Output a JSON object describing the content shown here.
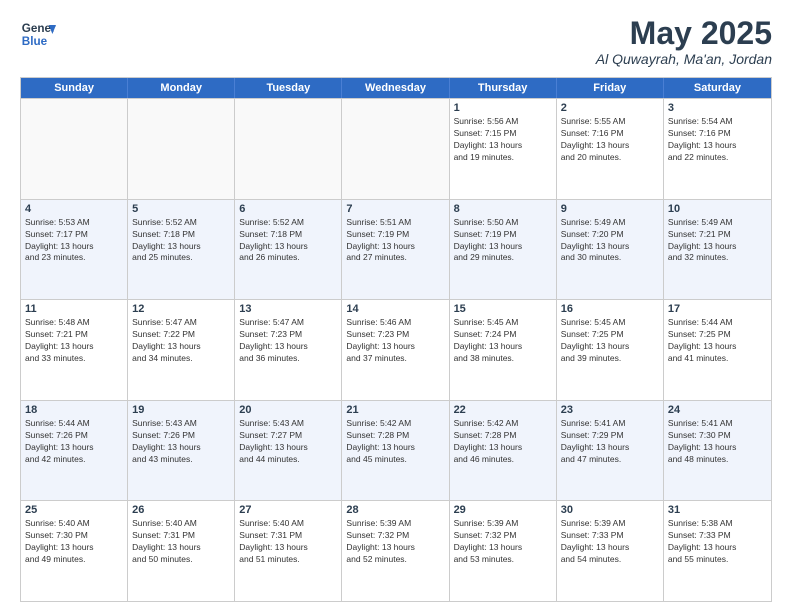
{
  "header": {
    "logo_line1": "General",
    "logo_line2": "Blue",
    "month": "May 2025",
    "location": "Al Quwayrah, Ma'an, Jordan"
  },
  "days_of_week": [
    "Sunday",
    "Monday",
    "Tuesday",
    "Wednesday",
    "Thursday",
    "Friday",
    "Saturday"
  ],
  "weeks": [
    [
      {
        "day": "",
        "info": ""
      },
      {
        "day": "",
        "info": ""
      },
      {
        "day": "",
        "info": ""
      },
      {
        "day": "",
        "info": ""
      },
      {
        "day": "1",
        "info": "Sunrise: 5:56 AM\nSunset: 7:15 PM\nDaylight: 13 hours\nand 19 minutes."
      },
      {
        "day": "2",
        "info": "Sunrise: 5:55 AM\nSunset: 7:16 PM\nDaylight: 13 hours\nand 20 minutes."
      },
      {
        "day": "3",
        "info": "Sunrise: 5:54 AM\nSunset: 7:16 PM\nDaylight: 13 hours\nand 22 minutes."
      }
    ],
    [
      {
        "day": "4",
        "info": "Sunrise: 5:53 AM\nSunset: 7:17 PM\nDaylight: 13 hours\nand 23 minutes."
      },
      {
        "day": "5",
        "info": "Sunrise: 5:52 AM\nSunset: 7:18 PM\nDaylight: 13 hours\nand 25 minutes."
      },
      {
        "day": "6",
        "info": "Sunrise: 5:52 AM\nSunset: 7:18 PM\nDaylight: 13 hours\nand 26 minutes."
      },
      {
        "day": "7",
        "info": "Sunrise: 5:51 AM\nSunset: 7:19 PM\nDaylight: 13 hours\nand 27 minutes."
      },
      {
        "day": "8",
        "info": "Sunrise: 5:50 AM\nSunset: 7:19 PM\nDaylight: 13 hours\nand 29 minutes."
      },
      {
        "day": "9",
        "info": "Sunrise: 5:49 AM\nSunset: 7:20 PM\nDaylight: 13 hours\nand 30 minutes."
      },
      {
        "day": "10",
        "info": "Sunrise: 5:49 AM\nSunset: 7:21 PM\nDaylight: 13 hours\nand 32 minutes."
      }
    ],
    [
      {
        "day": "11",
        "info": "Sunrise: 5:48 AM\nSunset: 7:21 PM\nDaylight: 13 hours\nand 33 minutes."
      },
      {
        "day": "12",
        "info": "Sunrise: 5:47 AM\nSunset: 7:22 PM\nDaylight: 13 hours\nand 34 minutes."
      },
      {
        "day": "13",
        "info": "Sunrise: 5:47 AM\nSunset: 7:23 PM\nDaylight: 13 hours\nand 36 minutes."
      },
      {
        "day": "14",
        "info": "Sunrise: 5:46 AM\nSunset: 7:23 PM\nDaylight: 13 hours\nand 37 minutes."
      },
      {
        "day": "15",
        "info": "Sunrise: 5:45 AM\nSunset: 7:24 PM\nDaylight: 13 hours\nand 38 minutes."
      },
      {
        "day": "16",
        "info": "Sunrise: 5:45 AM\nSunset: 7:25 PM\nDaylight: 13 hours\nand 39 minutes."
      },
      {
        "day": "17",
        "info": "Sunrise: 5:44 AM\nSunset: 7:25 PM\nDaylight: 13 hours\nand 41 minutes."
      }
    ],
    [
      {
        "day": "18",
        "info": "Sunrise: 5:44 AM\nSunset: 7:26 PM\nDaylight: 13 hours\nand 42 minutes."
      },
      {
        "day": "19",
        "info": "Sunrise: 5:43 AM\nSunset: 7:26 PM\nDaylight: 13 hours\nand 43 minutes."
      },
      {
        "day": "20",
        "info": "Sunrise: 5:43 AM\nSunset: 7:27 PM\nDaylight: 13 hours\nand 44 minutes."
      },
      {
        "day": "21",
        "info": "Sunrise: 5:42 AM\nSunset: 7:28 PM\nDaylight: 13 hours\nand 45 minutes."
      },
      {
        "day": "22",
        "info": "Sunrise: 5:42 AM\nSunset: 7:28 PM\nDaylight: 13 hours\nand 46 minutes."
      },
      {
        "day": "23",
        "info": "Sunrise: 5:41 AM\nSunset: 7:29 PM\nDaylight: 13 hours\nand 47 minutes."
      },
      {
        "day": "24",
        "info": "Sunrise: 5:41 AM\nSunset: 7:30 PM\nDaylight: 13 hours\nand 48 minutes."
      }
    ],
    [
      {
        "day": "25",
        "info": "Sunrise: 5:40 AM\nSunset: 7:30 PM\nDaylight: 13 hours\nand 49 minutes."
      },
      {
        "day": "26",
        "info": "Sunrise: 5:40 AM\nSunset: 7:31 PM\nDaylight: 13 hours\nand 50 minutes."
      },
      {
        "day": "27",
        "info": "Sunrise: 5:40 AM\nSunset: 7:31 PM\nDaylight: 13 hours\nand 51 minutes."
      },
      {
        "day": "28",
        "info": "Sunrise: 5:39 AM\nSunset: 7:32 PM\nDaylight: 13 hours\nand 52 minutes."
      },
      {
        "day": "29",
        "info": "Sunrise: 5:39 AM\nSunset: 7:32 PM\nDaylight: 13 hours\nand 53 minutes."
      },
      {
        "day": "30",
        "info": "Sunrise: 5:39 AM\nSunset: 7:33 PM\nDaylight: 13 hours\nand 54 minutes."
      },
      {
        "day": "31",
        "info": "Sunrise: 5:38 AM\nSunset: 7:33 PM\nDaylight: 13 hours\nand 55 minutes."
      }
    ]
  ]
}
